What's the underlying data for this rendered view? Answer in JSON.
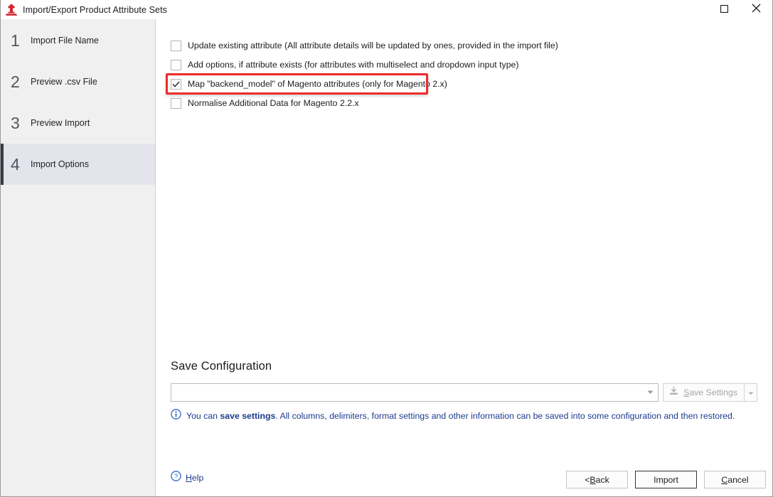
{
  "window": {
    "title": "Import/Export Product Attribute Sets",
    "app_icon": "magento-anvil-icon",
    "controls": [
      {
        "name": "maximize",
        "icon": "maximize-icon"
      },
      {
        "name": "close",
        "icon": "close-icon"
      }
    ]
  },
  "sidebar": {
    "steps": [
      {
        "num": "1",
        "label": "Import File Name",
        "active": false
      },
      {
        "num": "2",
        "label": "Preview .csv File",
        "active": false
      },
      {
        "num": "3",
        "label": "Preview Import",
        "active": false
      },
      {
        "num": "4",
        "label": "Import Options",
        "active": true
      }
    ]
  },
  "options": [
    {
      "label": "Update existing attribute (All attribute details will be updated by ones, provided in the import file)",
      "checked": false,
      "highlighted": false
    },
    {
      "label": "Add options, if attribute exists (for attributes with multiselect and dropdown input type)",
      "checked": false,
      "highlighted": false
    },
    {
      "label": "Map \"backend_model\" of Magento attributes (only for Magento 2.x)",
      "checked": true,
      "highlighted": true
    },
    {
      "label": "Normalise Additional Data for Magento 2.2.x",
      "checked": false,
      "highlighted": false
    }
  ],
  "save_configuration": {
    "title": "Save Configuration",
    "combo_value": "",
    "combo_placeholder": "",
    "save_settings_label_pre": "",
    "save_settings_accel": "S",
    "save_settings_label_post": "ave Settings",
    "save_settings_icon": "save-download-icon",
    "dropdown_icon": "chevron-down-icon",
    "info_icon": "info-icon",
    "info_text_pre": "You can ",
    "info_text_bold": "save settings",
    "info_text_post": ". All columns, delimiters, format settings and other information can be saved into some configuration and then restored."
  },
  "footer": {
    "help_icon": "help-circle-icon",
    "help_accel": "H",
    "help_label_pre": "",
    "help_label_post": "elp",
    "buttons": [
      {
        "name": "back",
        "label_pre": "< ",
        "accel": "B",
        "label_post": "ack",
        "default": false
      },
      {
        "name": "import",
        "label_pre": "Import",
        "accel": "",
        "label_post": "",
        "default": true
      },
      {
        "name": "cancel",
        "label_pre": "",
        "accel": "C",
        "label_post": "ancel",
        "default": false
      }
    ]
  },
  "colors": {
    "annotation_red": "#ee2b2b",
    "link_blue": "#1d3a8f",
    "sidebar_bg": "#f0f0f0",
    "sidebar_active_bg": "#e4e4ec",
    "sidebar_accent": "#3b3b47"
  }
}
